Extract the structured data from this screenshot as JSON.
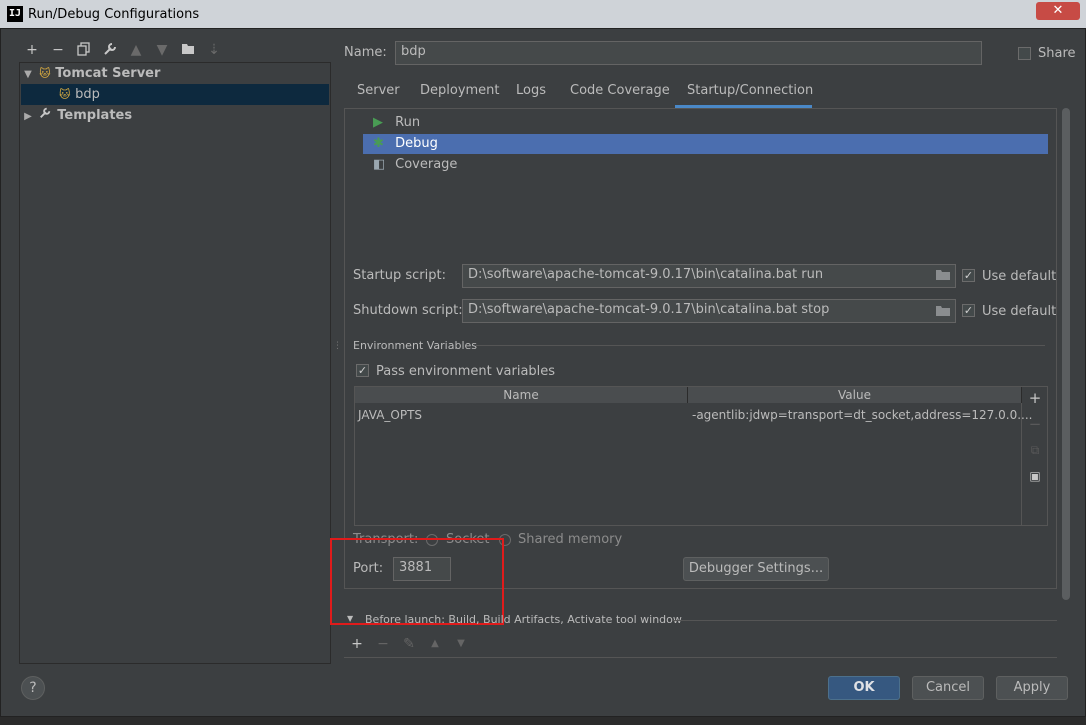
{
  "window": {
    "title": "Run/Debug Configurations",
    "app_icon": "IJ",
    "close_label": "✕"
  },
  "tree": {
    "items": [
      {
        "label": "Tomcat Server",
        "expanded": true
      },
      {
        "label": "bdp",
        "selected": true
      },
      {
        "label": "Templates",
        "expanded": false
      }
    ]
  },
  "config": {
    "name_label": "Name:",
    "name_value": "bdp",
    "share_label": "Share",
    "share_checked": false
  },
  "tabs": [
    {
      "label": "Server"
    },
    {
      "label": "Deployment"
    },
    {
      "label": "Logs"
    },
    {
      "label": "Code Coverage"
    },
    {
      "label": "Startup/Connection",
      "active": true
    }
  ],
  "modes": [
    {
      "label": "Run",
      "icon": "run-icon"
    },
    {
      "label": "Debug",
      "icon": "debug-icon",
      "selected": true
    },
    {
      "label": "Coverage",
      "icon": "coverage-icon"
    }
  ],
  "startup": {
    "label": "Startup script:",
    "value": "D:\\software\\apache-tomcat-9.0.17\\bin\\catalina.bat run",
    "use_default": "Use default"
  },
  "shutdown": {
    "label": "Shutdown script:",
    "value": "D:\\software\\apache-tomcat-9.0.17\\bin\\catalina.bat stop",
    "use_default": "Use default"
  },
  "env": {
    "section_label": "Environment Variables",
    "pass_label": "Pass environment variables",
    "columns": [
      "Name",
      "Value"
    ],
    "rows": [
      {
        "name": "JAVA_OPTS",
        "value": "-agentlib:jdwp=transport=dt_socket,address=127.0.0...."
      }
    ]
  },
  "transport": {
    "label": "Transport:",
    "options": [
      "Socket",
      "Shared memory"
    ]
  },
  "port": {
    "label": "Port:",
    "value": "3881"
  },
  "debugger_settings_label": "Debugger Settings...",
  "before_launch": {
    "label": "Before launch: Build, Build Artifacts, Activate tool window"
  },
  "buttons": {
    "ok": "OK",
    "cancel": "Cancel",
    "apply": "Apply",
    "help": "?"
  },
  "colors": {
    "accent": "#4a88c7",
    "selection": "#4b6eaf",
    "highlight_box": "#e01b1b"
  }
}
